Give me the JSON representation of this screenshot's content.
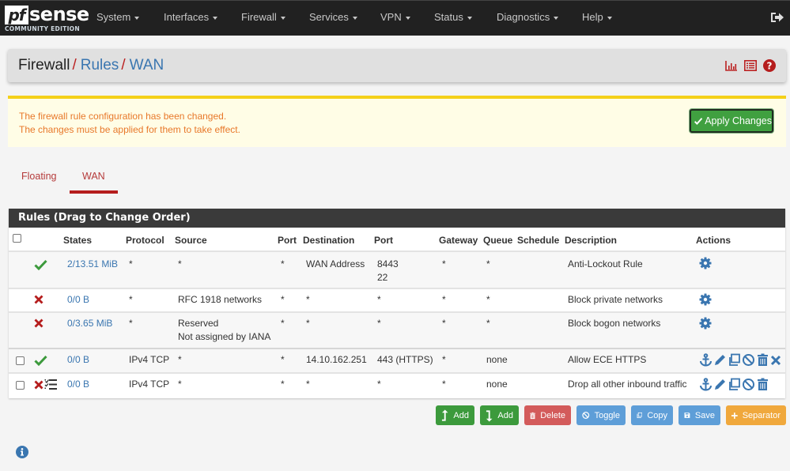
{
  "brand": {
    "logo_mark": "pf",
    "logo_text": "sense",
    "edition": "COMMUNITY EDITION"
  },
  "nav": {
    "items": [
      {
        "label": "System"
      },
      {
        "label": "Interfaces"
      },
      {
        "label": "Firewall"
      },
      {
        "label": "Services"
      },
      {
        "label": "VPN"
      },
      {
        "label": "Status"
      },
      {
        "label": "Diagnostics"
      },
      {
        "label": "Help"
      }
    ],
    "logout_icon": "sign-out-icon"
  },
  "breadcrumb": {
    "items": [
      "Firewall",
      "Rules",
      "WAN"
    ],
    "separator": "/",
    "icons": [
      "bar-chart-icon",
      "list-icon",
      "help-icon"
    ]
  },
  "alert": {
    "line1": "The firewall rule configuration has been changed.",
    "line2": "The changes must be applied for them to take effect.",
    "apply_label": "Apply Changes"
  },
  "tabs": [
    {
      "label": "Floating",
      "active": false
    },
    {
      "label": "WAN",
      "active": true
    }
  ],
  "rules": {
    "title": "Rules (Drag to Change Order)",
    "columns": [
      "States",
      "Protocol",
      "Source",
      "Port",
      "Destination",
      "Port",
      "Gateway",
      "Queue",
      "Schedule",
      "Description",
      "Actions"
    ],
    "rows": [
      {
        "selectable": false,
        "status": "pass",
        "states": "2/13.51 MiB",
        "protocol": "*",
        "source": "*",
        "source2": "",
        "sport": "*",
        "destination": "WAN Address",
        "dport": "8443",
        "dport2": "22",
        "gateway": "*",
        "queue": "*",
        "schedule": "",
        "description": "Anti-Lockout Rule",
        "actions": [
          "gear-icon"
        ]
      },
      {
        "selectable": false,
        "status": "block",
        "states": "0/0 B",
        "protocol": "*",
        "source": "RFC 1918 networks",
        "source2": "",
        "sport": "*",
        "destination": "*",
        "dport": "*",
        "dport2": "",
        "gateway": "*",
        "queue": "*",
        "schedule": "",
        "description": "Block private networks",
        "actions": [
          "gear-icon"
        ]
      },
      {
        "selectable": false,
        "status": "block",
        "states": "0/3.65 MiB",
        "protocol": "*",
        "source": "Reserved",
        "source2": "Not assigned by IANA",
        "sport": "*",
        "destination": "*",
        "dport": "*",
        "dport2": "",
        "gateway": "*",
        "queue": "*",
        "schedule": "",
        "description": "Block bogon networks",
        "actions": [
          "gear-icon"
        ]
      },
      {
        "selectable": true,
        "status": "pass",
        "states": "0/0 B",
        "protocol": "IPv4 TCP",
        "source": "*",
        "source2": "",
        "sport": "*",
        "destination": "14.10.162.251",
        "dport": "443 (HTTPS)",
        "dport2": "",
        "gateway": "*",
        "queue": "none",
        "schedule": "",
        "description": "Allow ECE HTTPS",
        "actions": [
          "anchor-icon",
          "pencil-icon",
          "copy-icon",
          "disable-icon",
          "trash-icon",
          "delete-x-icon"
        ]
      },
      {
        "selectable": true,
        "status": "block-logged",
        "states": "0/0 B",
        "protocol": "IPv4 TCP",
        "source": "*",
        "source2": "",
        "sport": "*",
        "destination": "*",
        "dport": "*",
        "dport2": "",
        "gateway": "*",
        "queue": "none",
        "schedule": "",
        "description": "Drop all other inbound traffic",
        "actions": [
          "anchor-icon",
          "pencil-icon",
          "copy-icon",
          "disable-icon",
          "trash-icon"
        ]
      }
    ]
  },
  "buttons": {
    "add_top": "Add",
    "add_bottom": "Add",
    "delete": "Delete",
    "toggle": "Toggle",
    "copy": "Copy",
    "save": "Save",
    "separator": "Separator"
  },
  "colors": {
    "navbar": "#212121",
    "link": "#3a76b0",
    "pass": "#3c9a3c",
    "block": "#b51d1d",
    "alert_border": "#f4d01a",
    "alert_text": "#e8782a"
  }
}
